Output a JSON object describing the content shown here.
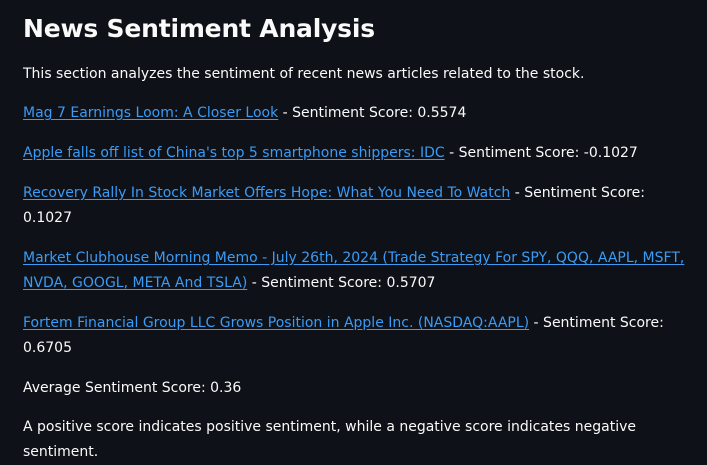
{
  "section": {
    "title": "News Sentiment Analysis",
    "intro": "This section analyzes the sentiment of recent news articles related to the stock."
  },
  "articles": [
    {
      "title": "Mag 7 Earnings Loom: A Closer Look",
      "score_text": " - Sentiment Score: 0.5574"
    },
    {
      "title": "Apple falls off list of China's top 5 smartphone shippers: IDC",
      "score_text": " - Sentiment Score: -0.1027"
    },
    {
      "title": "Recovery Rally In Stock Market Offers Hope: What You Need To Watch",
      "score_text": " - Sentiment Score: 0.1027"
    },
    {
      "title": "Market Clubhouse Morning Memo - July 26th, 2024 (Trade Strategy For SPY, QQQ, AAPL, MSFT, NVDA, GOOGL, META And TSLA)",
      "score_text": " - Sentiment Score: 0.5707"
    },
    {
      "title": "Fortem Financial Group LLC Grows Position in Apple Inc. (NASDAQ:AAPL)",
      "score_text": " - Sentiment Score: 0.6705"
    }
  ],
  "summary": {
    "average": "Average Sentiment Score: 0.36",
    "note": "A positive score indicates positive sentiment, while a negative score indicates negative sentiment."
  },
  "colors": {
    "background": "#0e1117",
    "text": "#fafafa",
    "link": "#3b9bf5"
  }
}
